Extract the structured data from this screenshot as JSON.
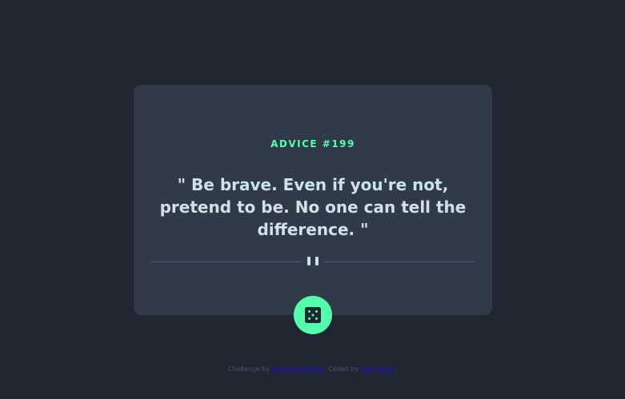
{
  "card": {
    "advice_label": "ADVICE #199",
    "quote": "\" Be brave. Even if you're not, pretend to be. No one can tell the difference. \""
  },
  "divider": {
    "icon": "pause-icon"
  },
  "dice_button": {
    "icon": "dice-icon",
    "color": "#53ffaa"
  },
  "attribution": {
    "prefix": "Challenge by ",
    "challenge_link": "Frontend Mentor",
    "middle": ". Coded by ",
    "author_link": "Your Name",
    "suffix": "."
  },
  "colors": {
    "background": "#202733",
    "card": "#313a48",
    "accent": "#53ffaa",
    "text": "#cee3e9",
    "divider": "#4f5d74"
  }
}
